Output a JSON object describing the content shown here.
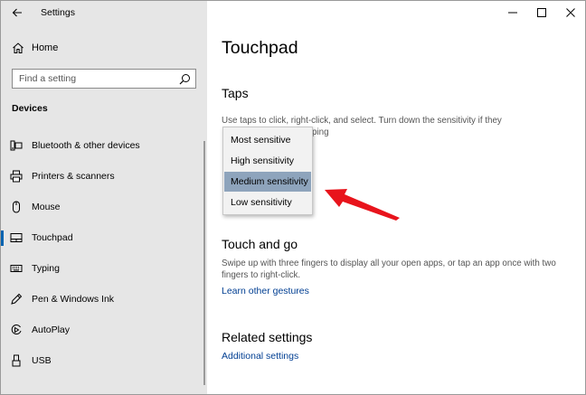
{
  "window": {
    "title": "Settings"
  },
  "sidebar": {
    "home_label": "Home",
    "search_placeholder": "Find a setting",
    "section_title": "Devices",
    "items": [
      {
        "label": "Bluetooth & other devices",
        "icon": "bluetooth-devices-icon"
      },
      {
        "label": "Printers & scanners",
        "icon": "printer-icon"
      },
      {
        "label": "Mouse",
        "icon": "mouse-icon"
      },
      {
        "label": "Touchpad",
        "icon": "touchpad-icon",
        "selected": true
      },
      {
        "label": "Typing",
        "icon": "keyboard-icon"
      },
      {
        "label": "Pen & Windows Ink",
        "icon": "pen-icon"
      },
      {
        "label": "AutoPlay",
        "icon": "autoplay-icon"
      },
      {
        "label": "USB",
        "icon": "usb-icon"
      }
    ]
  },
  "main": {
    "page_title": "Touchpad",
    "taps": {
      "heading": "Taps",
      "description_line1": "Use taps to click, right-click, and select. Turn down the sensitivity if they",
      "description_line2": "ping"
    },
    "sensitivity_dropdown": {
      "options": [
        "Most sensitive",
        "High sensitivity",
        "Medium sensitivity",
        "Low sensitivity"
      ],
      "selected": "Medium sensitivity"
    },
    "touch_and_go": {
      "heading": "Touch and go",
      "description": "Swipe up with three fingers to display all your open apps, or tap an app once with two fingers to right-click.",
      "link": "Learn other gestures"
    },
    "related": {
      "heading": "Related settings",
      "link": "Additional settings"
    }
  },
  "colors": {
    "sidebar_bg": "#e6e6e6",
    "accent": "#0063b1",
    "link": "#003e92",
    "dropdown_selected": "#8ea4bc",
    "annotation_arrow": "#e8141c"
  }
}
